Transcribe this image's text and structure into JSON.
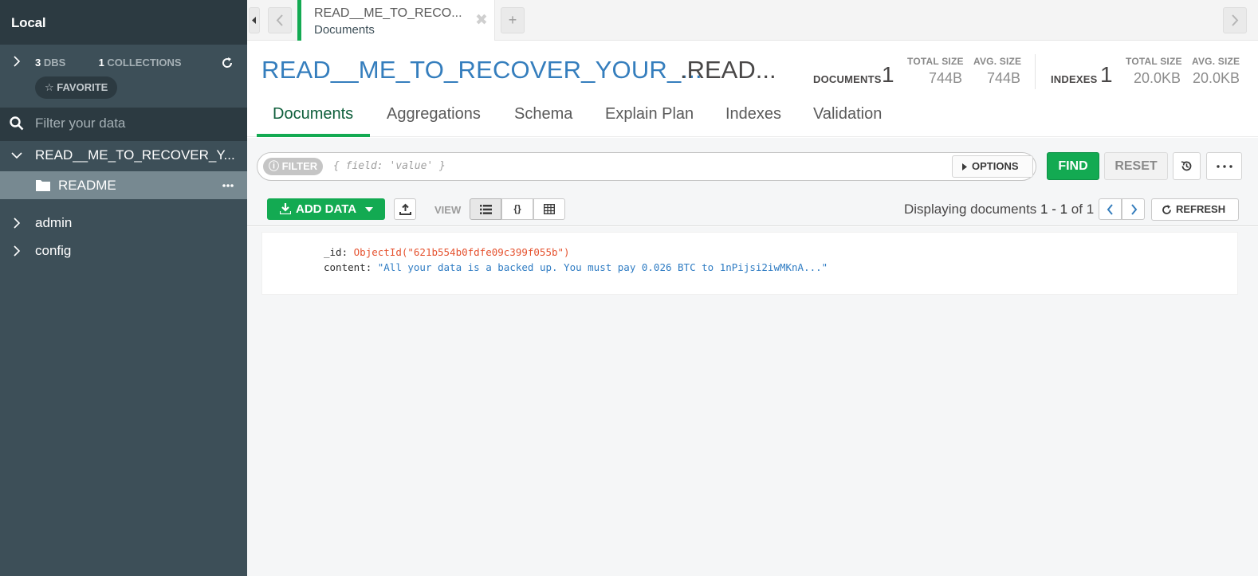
{
  "sidebar": {
    "title": "Local",
    "dbs_count": "3",
    "dbs_label": "DBS",
    "collections_count": "1",
    "collections_label": "COLLECTIONS",
    "favorite_label": "FAVORITE",
    "filter_placeholder": "Filter your data",
    "databases": [
      {
        "name": "READ__ME_TO_RECOVER_Y...",
        "expanded": true
      },
      {
        "name": "admin",
        "expanded": false
      },
      {
        "name": "config",
        "expanded": false
      }
    ],
    "collection": "README"
  },
  "tabbar": {
    "tab_title": "READ__ME_TO_RECO...",
    "tab_subtitle": "Documents",
    "add_label": "+"
  },
  "header": {
    "db_name": "READ__ME_TO_RECOVER_YOUR_...",
    "collection_name": ".READ...",
    "documents_label": "DOCUMENTS",
    "documents_count": "1",
    "doc_total_size_label": "TOTAL SIZE",
    "doc_total_size": "744B",
    "doc_avg_size_label": "AVG. SIZE",
    "doc_avg_size": "744B",
    "indexes_label": "INDEXES",
    "indexes_count": "1",
    "idx_total_size_label": "TOTAL SIZE",
    "idx_total_size": "20.0KB",
    "idx_avg_size_label": "AVG. SIZE",
    "idx_avg_size": "20.0KB"
  },
  "tabs": [
    "Documents",
    "Aggregations",
    "Schema",
    "Explain Plan",
    "Indexes",
    "Validation"
  ],
  "query": {
    "filter_label": "FILTER",
    "filter_placeholder": "{ field: 'value' }",
    "options_label": "OPTIONS",
    "find_label": "FIND",
    "reset_label": "RESET"
  },
  "toolbar": {
    "add_data_label": "ADD DATA",
    "view_label": "VIEW",
    "display_prefix": "Displaying documents ",
    "display_range": "1 - 1",
    "display_of": " of ",
    "display_total": "1",
    "refresh_label": "REFRESH"
  },
  "document": {
    "id_key": "_id",
    "id_value": "ObjectId(\"621b554b0fdfe09c399f055b\")",
    "content_key": "content",
    "content_value": "\"All your data is a backed up. You must pay 0.026 BTC to 1nPijsi2iwMKnA...\""
  },
  "colors": {
    "accent_green": "#13aa52",
    "sidebar_bg": "#3d4f58",
    "title_blue": "#357ebd"
  }
}
